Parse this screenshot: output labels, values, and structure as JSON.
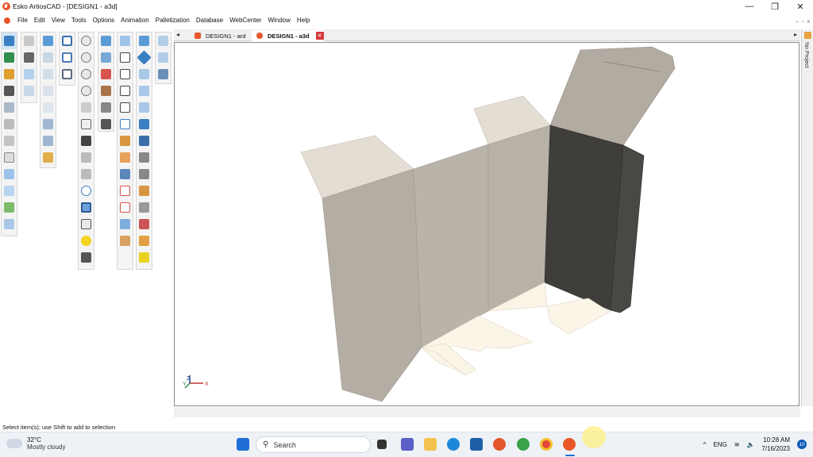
{
  "window": {
    "title": "Esko ArtiosCAD - [DESIGN1 - a3d]",
    "minimize": "—",
    "maximize": "❐",
    "close": "✕"
  },
  "menu": {
    "items": [
      "File",
      "Edit",
      "View",
      "Tools",
      "Options",
      "Animation",
      "Palletization",
      "Database",
      "WebCenter",
      "Window",
      "Help"
    ]
  },
  "tabs": [
    {
      "label": "DESIGN1 - ard",
      "active": false
    },
    {
      "label": "DESIGN1 - a3d",
      "active": true,
      "close": "×"
    }
  ],
  "tab_scroll": {
    "left": "◂",
    "right": "▸"
  },
  "side_panel": {
    "label": "No Project"
  },
  "axis_triad": {
    "z": "Z",
    "y": "Y",
    "x": "X"
  },
  "status": {
    "text": "Select item(s); use Shift to add to selection"
  },
  "taskbar": {
    "weather_temp": "32°C",
    "weather_cond": "Mostly cloudy",
    "search_placeholder": "Search",
    "lang": "ENG",
    "time": "10:28 AM",
    "date": "7/16/2023",
    "notifications": "10",
    "chevron": "^"
  },
  "colors": {
    "accent": "#e8562a",
    "board_light": "#b5afa4",
    "board_dark": "#3f3d3a",
    "board_flap": "#e0d9ce"
  }
}
